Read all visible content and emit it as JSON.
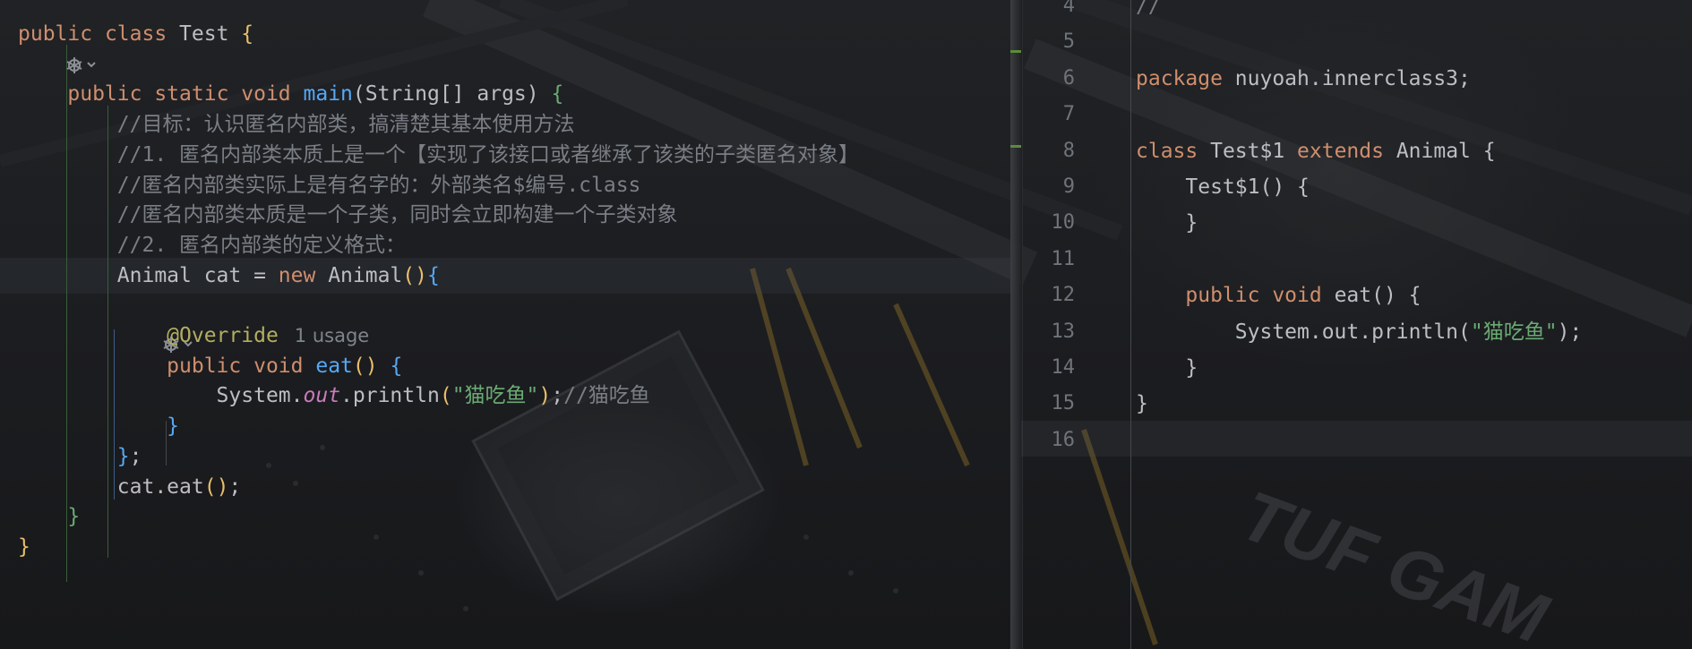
{
  "left_editor": {
    "lines": [
      [
        {
          "t": "public ",
          "c": "kw"
        },
        {
          "t": "class ",
          "c": "kw"
        },
        {
          "t": "Test ",
          "c": ""
        },
        {
          "t": "{",
          "c": "br1"
        }
      ],
      [
        {
          "t": "",
          "c": ""
        }
      ],
      [
        {
          "t": "    public ",
          "c": "kw"
        },
        {
          "t": "static ",
          "c": "kw"
        },
        {
          "t": "void ",
          "c": "kw"
        },
        {
          "t": "main",
          "c": "fn"
        },
        {
          "t": "(String[] args) ",
          "c": ""
        },
        {
          "t": "{",
          "c": "br2"
        }
      ],
      [
        {
          "t": "        //目标：认识匿名内部类，搞清楚其基本使用方法",
          "c": "cmt"
        }
      ],
      [
        {
          "t": "        //1. 匿名内部类本质上是一个【实现了该接口或者继承了该类的子类匿名对象】",
          "c": "cmt"
        }
      ],
      [
        {
          "t": "        //匿名内部类实际上是有名字的：外部类名$编号.class",
          "c": "cmt"
        }
      ],
      [
        {
          "t": "        //匿名内部类本质是一个子类，同时会立即构建一个子类对象",
          "c": "cmt"
        }
      ],
      [
        {
          "t": "        //2. 匿名内部类的定义格式：",
          "c": "cmt"
        }
      ],
      [
        {
          "t": "        Animal cat = ",
          "c": ""
        },
        {
          "t": "new ",
          "c": "kw"
        },
        {
          "t": "Animal",
          "c": ""
        },
        {
          "t": "()",
          "c": "br1"
        },
        {
          "t": "{",
          "c": "br3"
        }
      ],
      [
        {
          "t": "",
          "c": ""
        }
      ],
      [
        {
          "t": "            @Override",
          "c": "ann"
        }
      ],
      [
        {
          "t": "            public ",
          "c": "kw"
        },
        {
          "t": "void ",
          "c": "kw"
        },
        {
          "t": "eat",
          "c": "fn"
        },
        {
          "t": "() ",
          "c": "br1"
        },
        {
          "t": "{",
          "c": "br3"
        }
      ],
      [
        {
          "t": "                System.",
          "c": ""
        },
        {
          "t": "out",
          "c": "static"
        },
        {
          "t": ".println",
          "c": ""
        },
        {
          "t": "(",
          "c": "br1"
        },
        {
          "t": "\"猫吃鱼\"",
          "c": "str"
        },
        {
          "t": ")",
          "c": "br1"
        },
        {
          "t": ";",
          "c": ""
        },
        {
          "t": "//猫吃鱼",
          "c": "cmt"
        }
      ],
      [
        {
          "t": "            }",
          "c": "br3"
        }
      ],
      [
        {
          "t": "        }",
          "c": "br3"
        },
        {
          "t": ";",
          "c": ""
        }
      ],
      [
        {
          "t": "        cat.eat",
          "c": ""
        },
        {
          "t": "()",
          "c": "br1"
        },
        {
          "t": ";",
          "c": ""
        }
      ],
      [
        {
          "t": "    }",
          "c": "br2"
        }
      ],
      [
        {
          "t": "}",
          "c": "br1"
        }
      ]
    ],
    "usage_hint": "1 usage"
  },
  "right_editor": {
    "line_numbers": [
      "4",
      "5",
      "6",
      "7",
      "8",
      "9",
      "10",
      "11",
      "12",
      "13",
      "14",
      "15",
      "16"
    ],
    "lines": [
      [
        {
          "t": "//",
          "c": "cmt"
        }
      ],
      [
        {
          "t": "",
          "c": ""
        }
      ],
      [
        {
          "t": "package ",
          "c": "kw"
        },
        {
          "t": "nuyoah.innerclass3;",
          "c": ""
        }
      ],
      [
        {
          "t": "",
          "c": ""
        }
      ],
      [
        {
          "t": "class ",
          "c": "kw"
        },
        {
          "t": "Test$1 ",
          "c": ""
        },
        {
          "t": "extends ",
          "c": "kw"
        },
        {
          "t": "Animal {",
          "c": ""
        }
      ],
      [
        {
          "t": "    Test$1() {",
          "c": ""
        }
      ],
      [
        {
          "t": "    }",
          "c": ""
        }
      ],
      [
        {
          "t": "",
          "c": ""
        }
      ],
      [
        {
          "t": "    public ",
          "c": "kw"
        },
        {
          "t": "void ",
          "c": "kw"
        },
        {
          "t": "eat() {",
          "c": ""
        }
      ],
      [
        {
          "t": "        System.out.println(",
          "c": ""
        },
        {
          "t": "\"猫吃鱼\"",
          "c": "str"
        },
        {
          "t": ");",
          "c": ""
        }
      ],
      [
        {
          "t": "    }",
          "c": ""
        }
      ],
      [
        {
          "t": "}",
          "c": ""
        }
      ],
      [
        {
          "t": "",
          "c": ""
        }
      ]
    ]
  },
  "background_text": "TUF GAM",
  "colors": {
    "keyword": "#cf8e6d",
    "function": "#56a8f5",
    "string": "#6aab73",
    "comment": "#7a7e85",
    "annotation": "#b3ae60"
  }
}
